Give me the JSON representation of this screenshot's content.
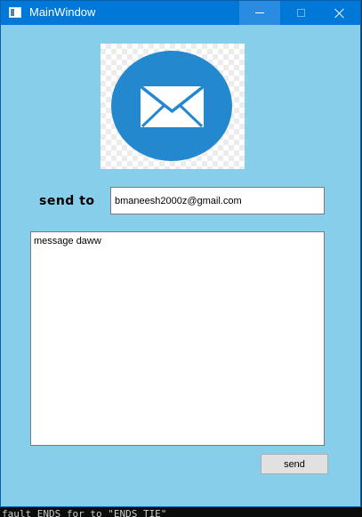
{
  "window": {
    "title": "MainWindow"
  },
  "titlebar": {
    "minimize_icon": "minimize-icon",
    "maximize_icon": "maximize-icon",
    "close_icon": "close-icon"
  },
  "logo": {
    "icon": "envelope-icon",
    "circle_color": "#2488cf",
    "envelope_color": "#ffffff"
  },
  "form": {
    "send_to_label": "send to",
    "email_value": "bmaneesh2000z@gmail.com",
    "message_value": "message daww",
    "send_button_label": "send"
  },
  "colors": {
    "window_background": "#87ceeb",
    "titlebar": "#0078d7"
  },
  "background_terminal": {
    "text": "fault ENDS for to \"ENDS TIE\""
  }
}
